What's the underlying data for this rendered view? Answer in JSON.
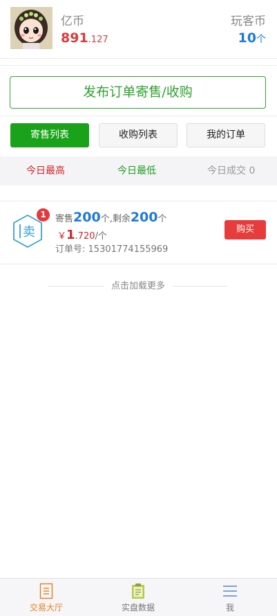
{
  "header": {
    "coin_left": {
      "label": "亿币",
      "value_int": "891",
      "value_dec": ".127"
    },
    "coin_right": {
      "label": "玩客币",
      "value_int": "10",
      "unit": "个"
    }
  },
  "publish_button": "发布订单寄售/收购",
  "tabs": [
    {
      "label": "寄售列表",
      "active": true
    },
    {
      "label": "收购列表",
      "active": false
    },
    {
      "label": "我的订单",
      "active": false
    }
  ],
  "stats": {
    "high": "今日最高",
    "low": "今日最低",
    "deal": "今日成交 0"
  },
  "orders": [
    {
      "type_glyph": "卖",
      "badge": "1",
      "sell_prefix": "寄售",
      "sell_qty": "200",
      "sell_unit_remain": "个,剩余",
      "remain_qty": "200",
      "remain_unit": "个",
      "yen": "￥",
      "price_int": "1",
      "price_dec": ".720",
      "per_unit": "/个",
      "order_no_label": "订单号:",
      "order_no": "15301774155969",
      "buy_label": "购买"
    }
  ],
  "load_more": "点击加载更多",
  "bottom_nav": [
    {
      "label": "交易大厅",
      "icon": "hall-icon",
      "active": true
    },
    {
      "label": "实盘数据",
      "icon": "clipboard-icon",
      "active": false
    },
    {
      "label": "我",
      "icon": "menu-icon",
      "active": false
    }
  ],
  "colors": {
    "green": "#1aa31a",
    "red": "#e63c3c",
    "blue": "#1e7ad8",
    "orange": "#e67e22"
  }
}
